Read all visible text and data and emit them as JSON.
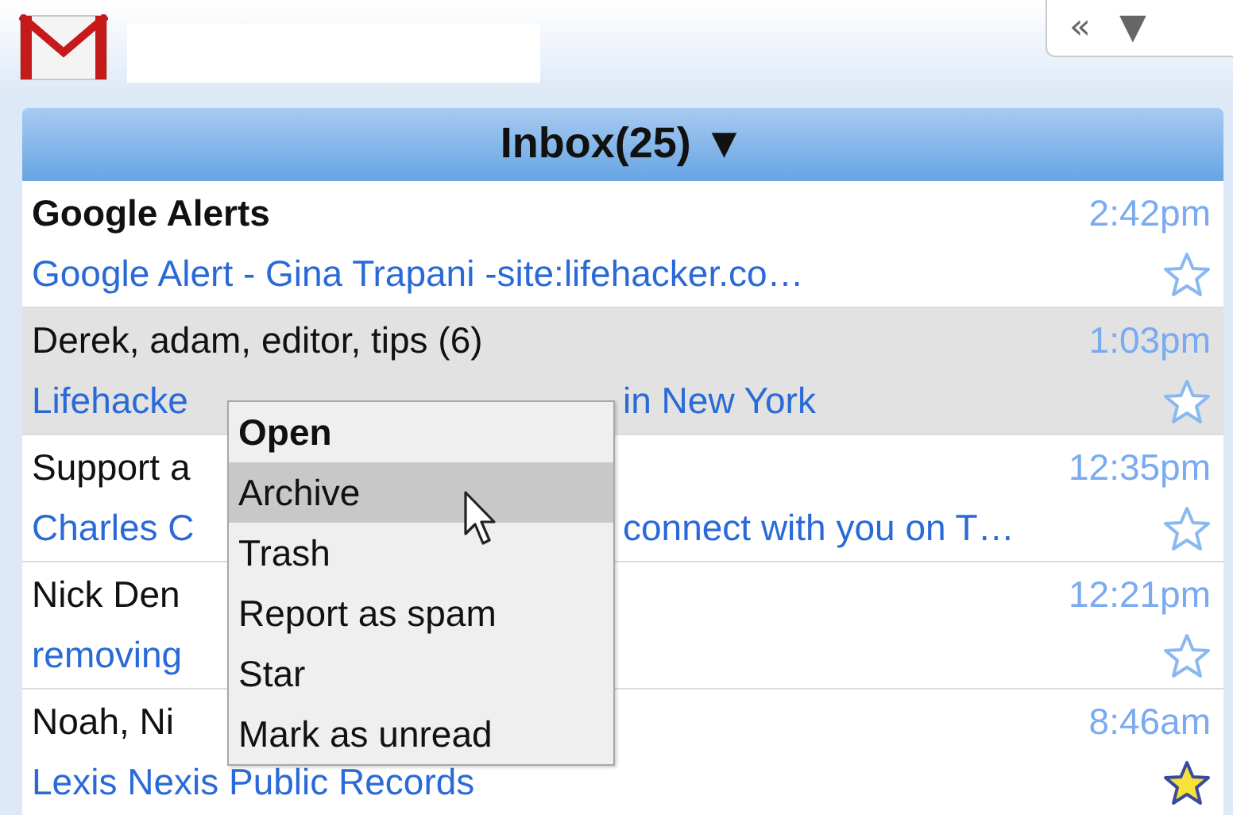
{
  "toolbar": {
    "buttons": [
      {
        "label": "«"
      },
      {
        "label": "▼"
      }
    ]
  },
  "inbox": {
    "title": "Inbox(25) ▼"
  },
  "messages": [
    {
      "sender": [
        "Google Alerts"
      ],
      "unread": true,
      "selected": false,
      "subject": [
        "Google Alert - Gina Trapani -site:lifehacker.co…"
      ],
      "time": "2:42pm",
      "starred": false
    },
    {
      "sender": [
        "Derek, adam, editor, tips (6)"
      ],
      "unread": false,
      "selected": true,
      "subject": [
        "Lifehacke",
        "in New York"
      ],
      "time": "1:03pm",
      "starred": false
    },
    {
      "sender": [
        "Support a"
      ],
      "unread": false,
      "selected": false,
      "subject": [
        "Charles C",
        "connect with you on T…"
      ],
      "time": "12:35pm",
      "starred": false
    },
    {
      "sender": [
        "Nick Den"
      ],
      "unread": false,
      "selected": false,
      "subject": [
        "removing"
      ],
      "time": "12:21pm",
      "starred": false
    },
    {
      "sender": [
        "Noah, Ni"
      ],
      "unread": false,
      "selected": false,
      "subject": [
        "Lexis Nexis Public Records"
      ],
      "time": "8:46am",
      "starred": true
    }
  ],
  "context_menu": {
    "items": [
      {
        "label": "Open",
        "kind": "default",
        "selected": false
      },
      {
        "label": "Archive",
        "kind": "normal",
        "selected": true
      },
      {
        "label": "Trash",
        "kind": "normal",
        "selected": false
      },
      {
        "label": "Report as spam",
        "kind": "normal",
        "selected": false
      },
      {
        "label": "Star",
        "kind": "normal",
        "selected": false
      },
      {
        "label": "Mark as unread",
        "kind": "normal",
        "selected": false
      }
    ]
  }
}
